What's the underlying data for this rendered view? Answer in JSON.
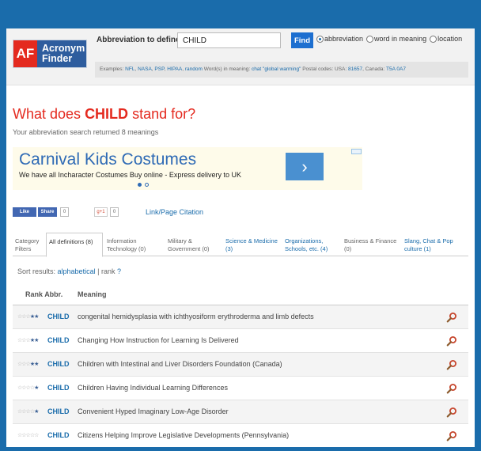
{
  "logo": {
    "mark": "AF",
    "name_line1": "Acronym",
    "name_line2": "Finder"
  },
  "search": {
    "label": "Abbreviation to define",
    "value": "CHILD",
    "find_label": "Find",
    "options": [
      {
        "label": "abbreviation",
        "selected": true
      },
      {
        "label": "word in meaning",
        "selected": false
      },
      {
        "label": "location",
        "selected": false
      }
    ]
  },
  "examples": {
    "prefix": "Examples:",
    "items": [
      "NFL",
      "NASA",
      "PSP",
      "HIPAA",
      "random"
    ],
    "meaning_prefix": "Word(s) in meaning:",
    "meaning_items": [
      "chat",
      "\"global warming\""
    ],
    "postal_prefix": "Postal codes: USA:",
    "usa_code": "81657",
    "canada_prefix": "Canada:",
    "canada_code": "T5A 0A7"
  },
  "page": {
    "title_prefix": "What does",
    "title_abbr": "CHILD",
    "title_suffix": "stand for?",
    "subtitle": "Your abbreviation search returned 8 meanings"
  },
  "ad": {
    "title": "Carnival Kids Costumes",
    "body": "We have all Incharacter Costumes Buy online - Express delivery to UK",
    "arrow": "›"
  },
  "social": {
    "like": "Like",
    "share": "Share",
    "fb_count": "0",
    "gplus": "g+1",
    "gplus_count": "0",
    "citation": "Link/Page Citation"
  },
  "categories": {
    "filter_line1": "Category",
    "filter_line2": "Filters",
    "tabs": [
      {
        "line1": "All definitions (8)",
        "line2": ""
      },
      {
        "line1": "Information",
        "line2": "Technology (0)"
      },
      {
        "line1": "Military &",
        "line2": "Government (0)"
      },
      {
        "line1": "Science & Medicine",
        "line2": "(3)"
      },
      {
        "line1": "Organizations,",
        "line2": "Schools, etc. (4)"
      },
      {
        "line1": "Business & Finance",
        "line2": "(0)"
      },
      {
        "line1": "Slang, Chat & Pop",
        "line2": "culture (1)"
      }
    ]
  },
  "sort": {
    "label": "Sort results:",
    "alphabetical": "alphabetical",
    "separator": "|",
    "rank": "rank",
    "help": "?"
  },
  "table": {
    "col_rank": "Rank",
    "col_abbr": "Abbr.",
    "col_meaning": "Meaning",
    "rows": [
      {
        "abbr": "CHILD",
        "meaning": "congenital hemidysplasia with ichthyosiform erythroderma and limb defects",
        "stars": 2
      },
      {
        "abbr": "CHILD",
        "meaning": "Changing How Instruction for Learning Is Delivered",
        "stars": 2
      },
      {
        "abbr": "CHILD",
        "meaning": "Children with Intestinal and Liver Disorders Foundation (Canada)",
        "stars": 2
      },
      {
        "abbr": "CHILD",
        "meaning": "Children Having Individual Learning Differences",
        "stars": 1
      },
      {
        "abbr": "CHILD",
        "meaning": "Convenient Hyped Imaginary Low-Age Disorder",
        "stars": 1
      },
      {
        "abbr": "CHILD",
        "meaning": "Citizens Helping Improve Legislative Developments (Pennsylvania)",
        "stars": 0
      }
    ]
  },
  "colors": {
    "brand_blue": "#1a6cab",
    "brand_red": "#e42a1f",
    "link": "#1a6cab"
  }
}
